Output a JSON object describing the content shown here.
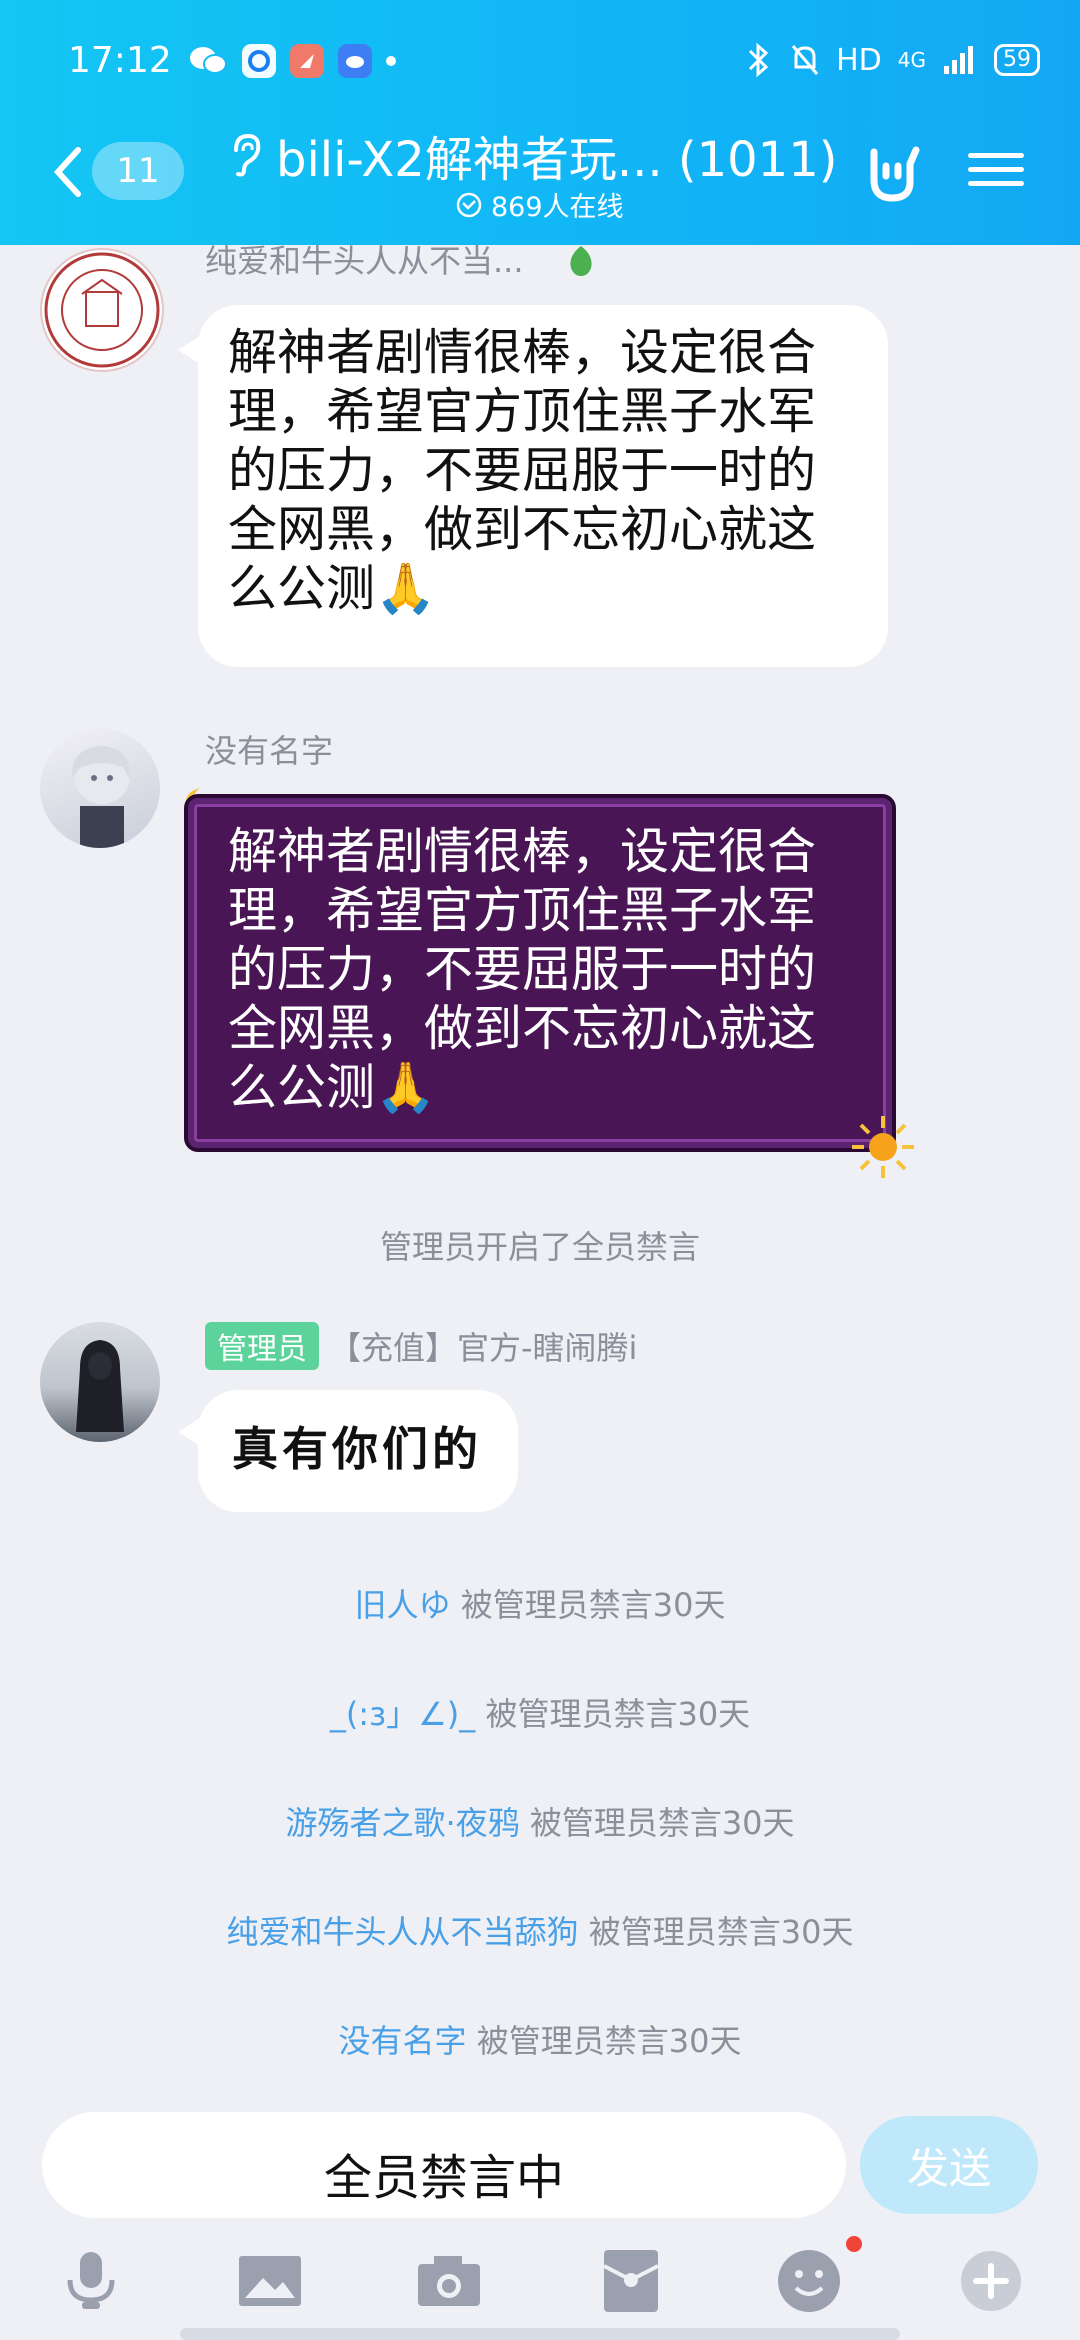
{
  "status_bar": {
    "time": "17:12",
    "network": "HD",
    "signal": "4G",
    "battery": "59"
  },
  "nav": {
    "unread_count": "11",
    "group_title": "bili-X2解神者玩... (1011)",
    "online": "869人在线"
  },
  "messages": [
    {
      "sender": "纯爱和牛头人从不当...",
      "text": "解神者剧情很棒，设定很合理，希望官方顶住黑子水军的压力，不要屈服于一时的全网黑，做到不忘初心就这么公测🙏"
    },
    {
      "sender": "没有名字",
      "text": "解神者剧情很棒，设定很合理，希望官方顶住黑子水军的压力，不要屈服于一时的全网黑，做到不忘初心就这么公测🙏"
    },
    {
      "system": "管理员开启了全员禁言"
    },
    {
      "role_tag": "管理员",
      "sender": "【充值】官方-瞎闹腾i",
      "text": "真有你们的"
    }
  ],
  "mute_notices": [
    {
      "who": "旧人ゆ",
      "action": "被管理员禁言30天"
    },
    {
      "who": "_(:з」∠)_",
      "action": "被管理员禁言30天"
    },
    {
      "who": "游殇者之歌·夜鸦",
      "action": "被管理员禁言30天"
    },
    {
      "who": "纯爱和牛头人从不当舔狗",
      "action": "被管理员禁言30天"
    },
    {
      "who": "没有名字",
      "action": "被管理员禁言30天"
    }
  ],
  "input": {
    "placeholder": "全员禁言中",
    "send_label": "发送"
  },
  "colors": {
    "header": "#13b9f5",
    "background": "#eef0f6",
    "system_name": "#4aa0e6",
    "admin_tag": "#5cd39a",
    "purple_bubble": "#4a1555"
  }
}
